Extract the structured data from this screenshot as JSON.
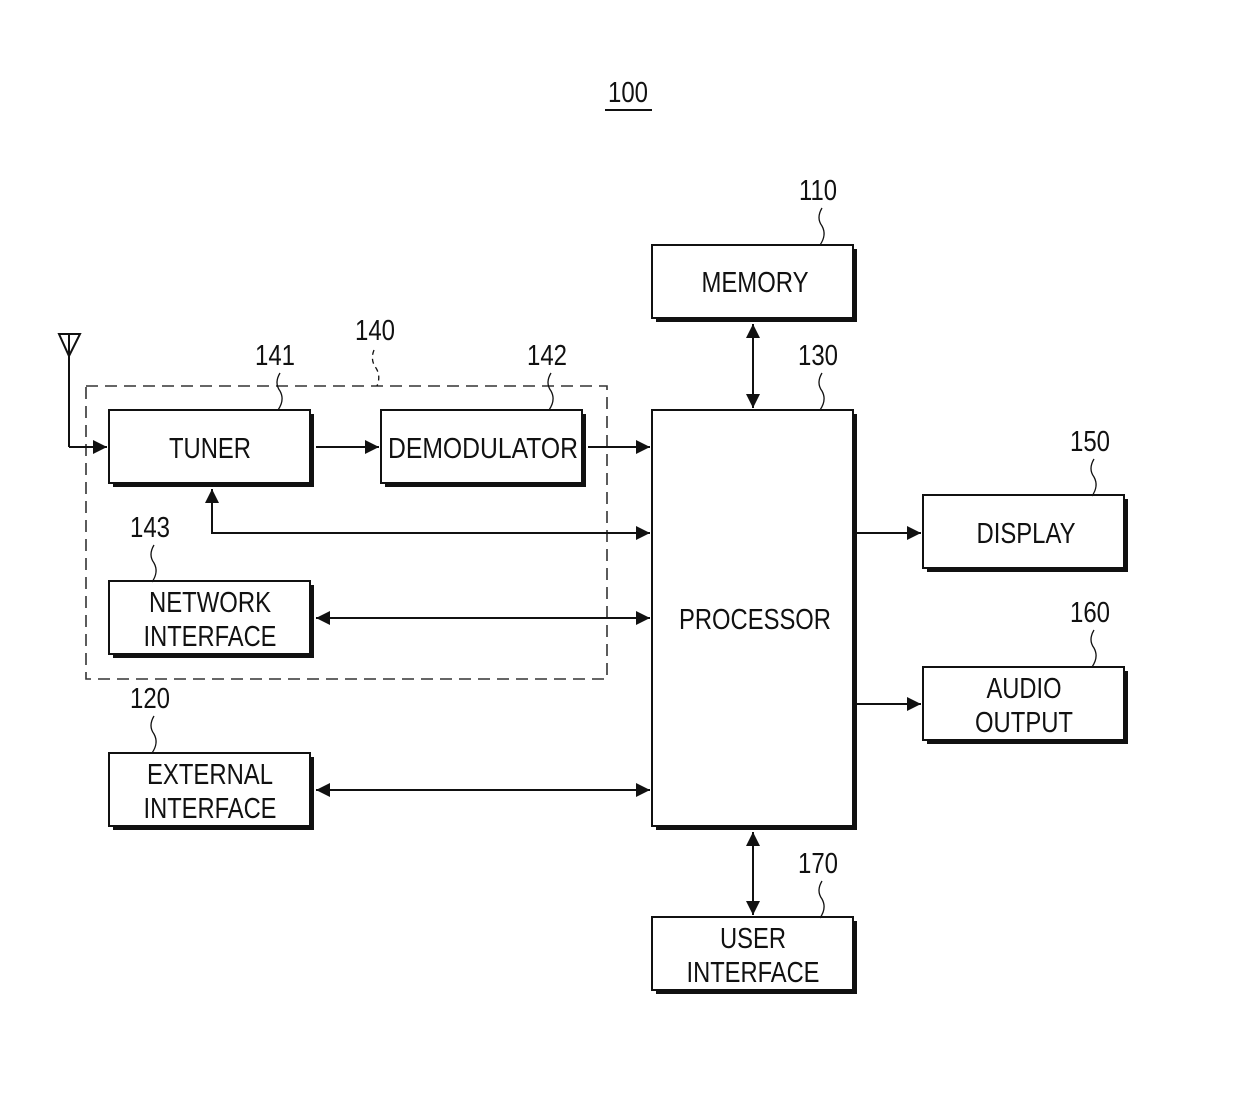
{
  "figure": {
    "ref": "100"
  },
  "blocks": {
    "memory": {
      "ref": "110",
      "lines": [
        "MEMORY"
      ]
    },
    "processor": {
      "ref": "130",
      "lines": [
        "PROCESSOR"
      ]
    },
    "receiver_group": {
      "ref": "140"
    },
    "tuner": {
      "ref": "141",
      "lines": [
        "TUNER"
      ]
    },
    "demodulator": {
      "ref": "142",
      "lines": [
        "DEMODULATOR"
      ]
    },
    "network_interface": {
      "ref": "143",
      "lines": [
        "NETWORK",
        "INTERFACE"
      ]
    },
    "external_interface": {
      "ref": "120",
      "lines": [
        "EXTERNAL",
        "INTERFACE"
      ]
    },
    "display": {
      "ref": "150",
      "lines": [
        "DISPLAY"
      ]
    },
    "audio_output": {
      "ref": "160",
      "lines": [
        "AUDIO",
        "OUTPUT"
      ]
    },
    "user_interface": {
      "ref": "170",
      "lines": [
        "USER",
        "INTERFACE"
      ]
    }
  },
  "connections": [
    {
      "from": "antenna",
      "to": "tuner",
      "direction": "one-way"
    },
    {
      "from": "tuner",
      "to": "demodulator",
      "direction": "one-way"
    },
    {
      "from": "demodulator",
      "to": "processor",
      "direction": "one-way"
    },
    {
      "from": "processor",
      "to": "tuner",
      "direction": "two-way"
    },
    {
      "from": "network_interface",
      "to": "processor",
      "direction": "two-way"
    },
    {
      "from": "external_interface",
      "to": "processor",
      "direction": "two-way"
    },
    {
      "from": "memory",
      "to": "processor",
      "direction": "two-way"
    },
    {
      "from": "processor",
      "to": "display",
      "direction": "one-way"
    },
    {
      "from": "processor",
      "to": "audio_output",
      "direction": "one-way"
    },
    {
      "from": "user_interface",
      "to": "processor",
      "direction": "two-way"
    }
  ]
}
